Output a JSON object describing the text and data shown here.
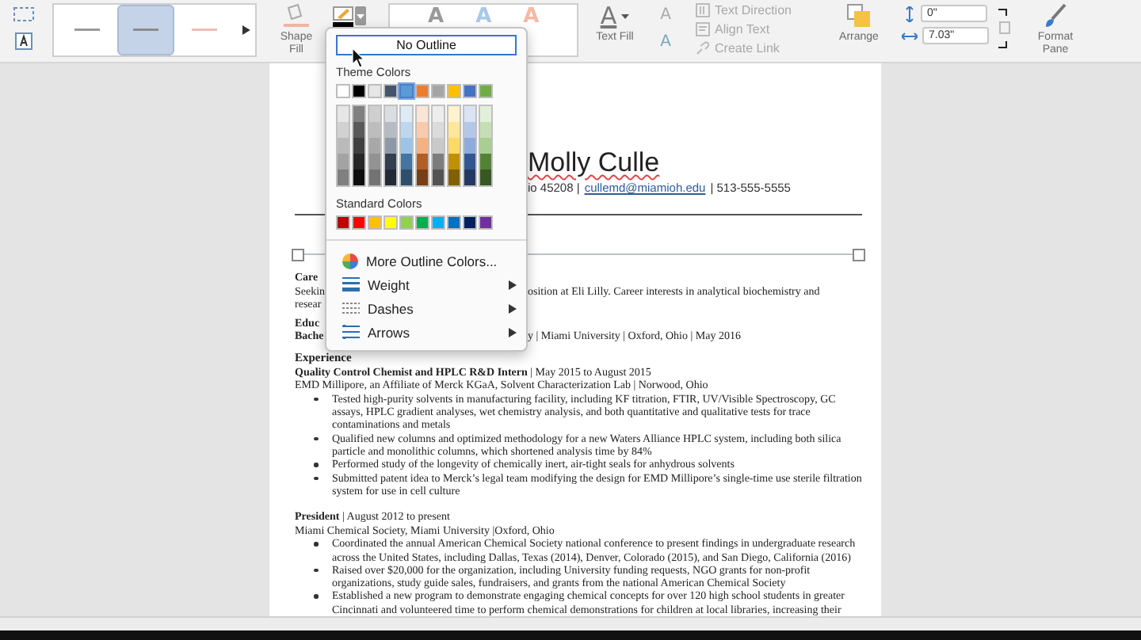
{
  "ribbon": {
    "line_styles": [
      {
        "color": "#9a9a9a",
        "selected": false
      },
      {
        "color": "#8c8c8c",
        "selected": true
      },
      {
        "color": "#f0bcb4",
        "selected": false
      }
    ],
    "shape_fill_label": "Shape Fill",
    "outline_menu_open": true,
    "wordart_styles": [
      {
        "letter": "A",
        "color": "#9a9a9a"
      },
      {
        "letter": "A",
        "color": "#a9c9ea"
      },
      {
        "letter": "A",
        "color": "#f5b9a2"
      }
    ],
    "text_fill": {
      "letter": "A",
      "label": "Text Fill"
    },
    "text_outline_letter": "A",
    "text_effects_letter": "A",
    "text_commands": [
      {
        "kind": "direction",
        "label": "Text Direction",
        "disabled": true
      },
      {
        "kind": "align",
        "label": "Align Text",
        "disabled": true
      },
      {
        "kind": "link",
        "label": "Create Link",
        "disabled": true
      }
    ],
    "arrange_label": "Arrange",
    "height_value": "0\"",
    "width_value": "7.03\"",
    "format_pane_label": "Format Pane"
  },
  "outline_menu": {
    "no_outline": "No Outline",
    "theme_label": "Theme Colors",
    "theme_colors": [
      {
        "color": "#ffffff",
        "selected": false
      },
      {
        "color": "#000000",
        "selected": false
      },
      {
        "color": "#e7e6e6",
        "selected": false
      },
      {
        "color": "#44546a",
        "selected": false
      },
      {
        "color": "#5b9bd5",
        "selected": true
      },
      {
        "color": "#ed7d31",
        "selected": false
      },
      {
        "color": "#a5a5a5",
        "selected": false
      },
      {
        "color": "#ffc000",
        "selected": false
      },
      {
        "color": "#4472c4",
        "selected": false
      },
      {
        "color": "#70ad47",
        "selected": false
      }
    ],
    "standard_label": "Standard Colors",
    "standard_colors": [
      {
        "color": "#c00000",
        "selected": false
      },
      {
        "color": "#ff0000",
        "selected": false
      },
      {
        "color": "#ffc000",
        "selected": false
      },
      {
        "color": "#ffff00",
        "selected": false
      },
      {
        "color": "#92d050",
        "selected": false
      },
      {
        "color": "#00b050",
        "selected": false
      },
      {
        "color": "#00b0f0",
        "selected": false
      },
      {
        "color": "#0070c0",
        "selected": false
      },
      {
        "color": "#002060",
        "selected": false
      },
      {
        "color": "#7030a0",
        "selected": false
      }
    ],
    "items": [
      {
        "kind": "colors",
        "label": "More Outline Colors...",
        "has_submenu": false
      },
      {
        "kind": "weight",
        "label": "Weight",
        "has_submenu": true
      },
      {
        "kind": "dashes",
        "label": "Dashes",
        "has_submenu": true
      },
      {
        "kind": "arrows",
        "label": "Arrows",
        "has_submenu": true
      }
    ]
  },
  "document": {
    "name": "Molly Culle",
    "contact_before": "io 45208 |",
    "email": "cullemd@miamioh.edu",
    "contact_after": "| 513-555-5555",
    "covered_lines": [
      {
        "kind": "heading",
        "left": "Care"
      },
      {
        "kind": "body",
        "left": "Seekin",
        "right": "osition at Eli Lilly. Career interests in analytical biochemistry and"
      },
      {
        "kind": "body",
        "left": "resear"
      },
      {
        "kind": "heading",
        "left": "Educ"
      },
      {
        "kind": "subhead",
        "left": "Bache",
        "right": "y | Miami University | Oxford, Ohio | May 2016"
      }
    ],
    "sections": [
      {
        "heading": "Experience",
        "entries": [
          {
            "title": "**Quality Control Chemist and HPLC R&D Intern** | May 2015 to August 2015",
            "org": "EMD Millipore, an Affiliate of Merck KGaA, Solvent Characterization Lab | Norwood, Ohio",
            "bullets": [
              "Tested high-purity solvents in manufacturing facility, including KF titration, FTIR, UV/Visible Spectroscopy, GC assays, HPLC gradient analyses, wet chemistry analysis, and both quantitative and qualitative tests for trace contaminations and metals",
              "Qualified new columns and optimized methodology for a new Waters Alliance HPLC system, including both silica particle and monolithic columns, which shortened analysis time by 84%",
              "Performed study of the longevity of chemically inert, air-tight seals for anhydrous solvents",
              "Submitted patent idea to Merck’s legal team modifying the design for EMD Millipore’s single-time use sterile filtration system for use in cell culture"
            ]
          },
          {
            "title": "**President** | August 2012 to present",
            "org": "Miami Chemical Society, Miami University |Oxford, Ohio",
            "bullets": [
              "Coordinated the annual American Chemical Society national conference to present findings in undergraduate research across the United States, including Dallas, Texas (2014), Denver, Colorado (2015), and San Diego, California (2016)",
              "Raised over $20,000 for the organization, including University funding requests, NGO grants for non-profit organizations, study guide sales, fundraisers, and grants from the national American Chemical Society",
              "Established a new program to demonstrate engaging chemical concepts for over 120 high school students in greater Cincinnati and volunteered time to perform chemical demonstrations for children at local libraries, increasing their"
            ]
          }
        ]
      }
    ]
  }
}
